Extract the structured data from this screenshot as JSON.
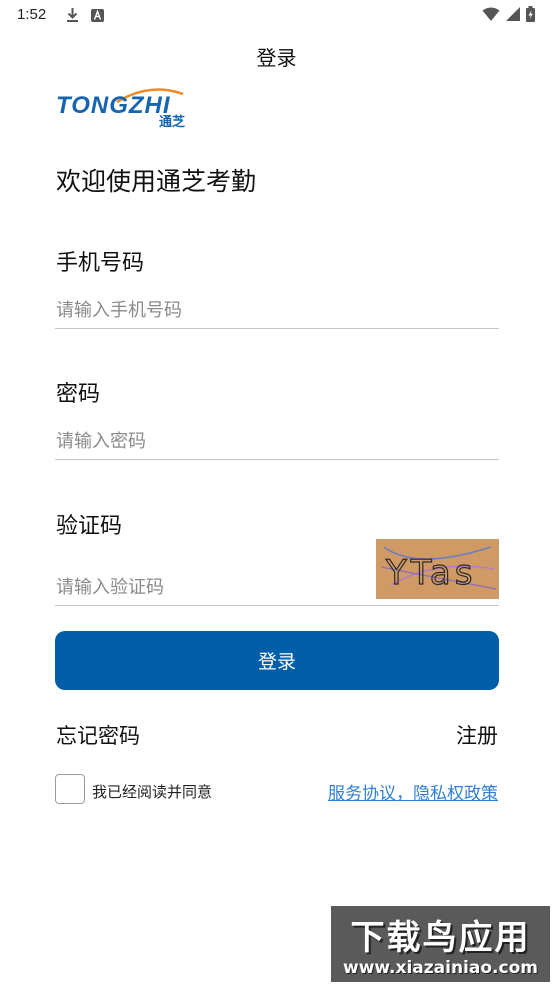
{
  "status_bar": {
    "time": "1:52",
    "icons": [
      "download-icon",
      "a-badge-icon",
      "wifi-icon",
      "signal-icon",
      "battery-icon"
    ]
  },
  "app": {
    "title": "登录",
    "logo_text": "TONGZHI",
    "logo_subtext": "通芝",
    "welcome": "欢迎使用通芝考勤"
  },
  "form": {
    "phone_label": "手机号码",
    "phone_placeholder": "请输入手机号码",
    "password_label": "密码",
    "password_placeholder": "请输入密码",
    "captcha_label": "验证码",
    "captcha_placeholder": "请输入验证码",
    "captcha_text": "YTas",
    "login_label": "登录"
  },
  "links": {
    "forgot": "忘记密码",
    "register": "注册",
    "agree_text": "我已经阅读并同意",
    "policy": "服务协议，隐私权政策"
  },
  "watermark": {
    "top": "下载鸟应用",
    "bottom": "www.xiazainiao.com"
  },
  "colors": {
    "primary": "#005ea8",
    "link": "#2f7fd3",
    "captcha_bg": "#cf9a66",
    "logo_blue": "#1565b0",
    "logo_orange": "#f08a24"
  }
}
